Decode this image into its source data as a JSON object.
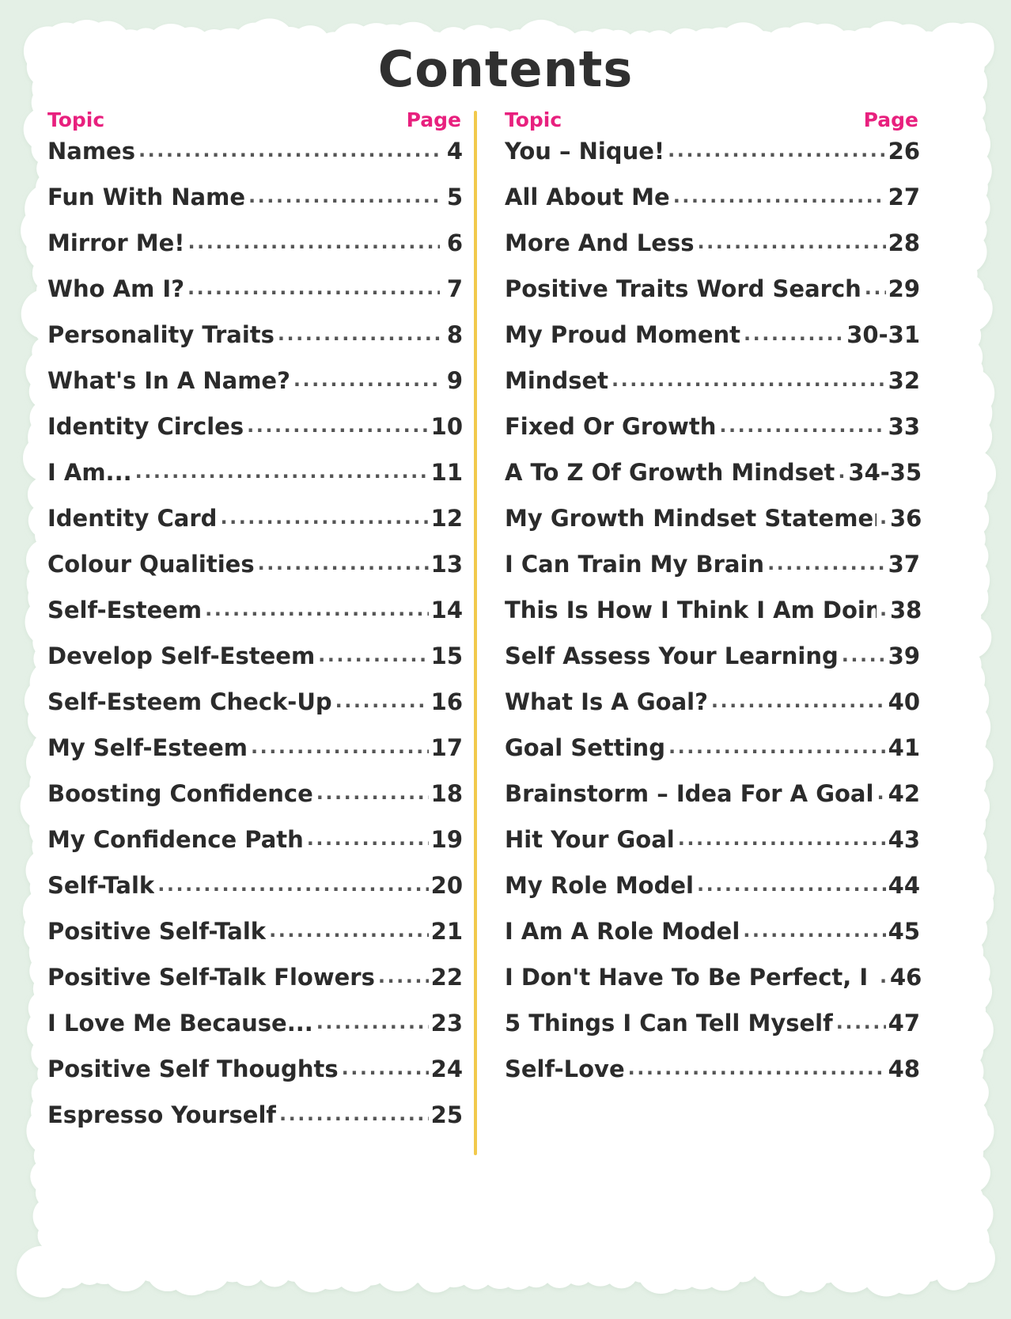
{
  "page": {
    "title": "Contents",
    "background_color": "#e4f0e6",
    "paper_color": "#ffffff",
    "title_color": "#303030",
    "heading_color": "#e8207e",
    "divider_color": "#f2c94c",
    "text_color": "#2b2b2b"
  },
  "columns": [
    {
      "name": "left-column",
      "header": {
        "topic": "Topic",
        "page": "Page"
      },
      "entries": [
        {
          "topic": "Names",
          "page": "4"
        },
        {
          "topic": "Fun With Name",
          "page": "5"
        },
        {
          "topic": "Mirror Me!",
          "page": "6"
        },
        {
          "topic": "Who Am I?",
          "page": "7"
        },
        {
          "topic": "Personality Traits",
          "page": "8"
        },
        {
          "topic": "What's In A Name?",
          "page": "9"
        },
        {
          "topic": "Identity Circles",
          "page": "10"
        },
        {
          "topic": "I Am...",
          "page": "11"
        },
        {
          "topic": "Identity Card",
          "page": "12"
        },
        {
          "topic": "Colour Qualities",
          "page": "13"
        },
        {
          "topic": "Self-Esteem",
          "page": "14"
        },
        {
          "topic": "Develop Self-Esteem",
          "page": "15"
        },
        {
          "topic": "Self-Esteem Check-Up",
          "page": "16"
        },
        {
          "topic": "My Self-Esteem",
          "page": "17"
        },
        {
          "topic": "Boosting Confidence",
          "page": "18"
        },
        {
          "topic": "My Confidence Path",
          "page": "19"
        },
        {
          "topic": "Self-Talk",
          "page": "20"
        },
        {
          "topic": "Positive Self-Talk",
          "page": "21"
        },
        {
          "topic": "Positive Self-Talk Flowers",
          "page": "22"
        },
        {
          "topic": "I Love Me Because...",
          "page": "23"
        },
        {
          "topic": "Positive Self Thoughts",
          "page": "24"
        },
        {
          "topic": "Espresso Yourself",
          "page": "25"
        }
      ]
    },
    {
      "name": "right-column",
      "header": {
        "topic": "Topic",
        "page": "Page"
      },
      "entries": [
        {
          "topic": "You – Nique!",
          "page": "26"
        },
        {
          "topic": "All About Me",
          "page": "27"
        },
        {
          "topic": "More And Less",
          "page": "28"
        },
        {
          "topic": "Positive Traits Word Search",
          "page": "29"
        },
        {
          "topic": "My Proud Moment",
          "page": "30-31"
        },
        {
          "topic": "Mindset",
          "page": "32"
        },
        {
          "topic": "Fixed Or Growth",
          "page": "33"
        },
        {
          "topic": "A To Z Of Growth Mindset",
          "page": "34-35"
        },
        {
          "topic": "My Growth Mindset Statements",
          "page": "36"
        },
        {
          "topic": "I Can Train My Brain",
          "page": "37"
        },
        {
          "topic": "This Is How I Think I Am Doing",
          "page": "38"
        },
        {
          "topic": "Self Assess Your Learning",
          "page": "39"
        },
        {
          "topic": "What Is A Goal?",
          "page": "40"
        },
        {
          "topic": "Goal Setting",
          "page": "41"
        },
        {
          "topic": "Brainstorm – Idea For A Goal",
          "page": "42"
        },
        {
          "topic": "Hit Your Goal",
          "page": "43"
        },
        {
          "topic": "My Role Model",
          "page": "44"
        },
        {
          "topic": "I Am A Role Model",
          "page": "45"
        },
        {
          "topic": "I Don't Have To Be Perfect, I Can...",
          "page": "46"
        },
        {
          "topic": "5 Things I Can Tell Myself",
          "page": "47"
        },
        {
          "topic": "Self-Love",
          "page": "48"
        }
      ]
    }
  ]
}
